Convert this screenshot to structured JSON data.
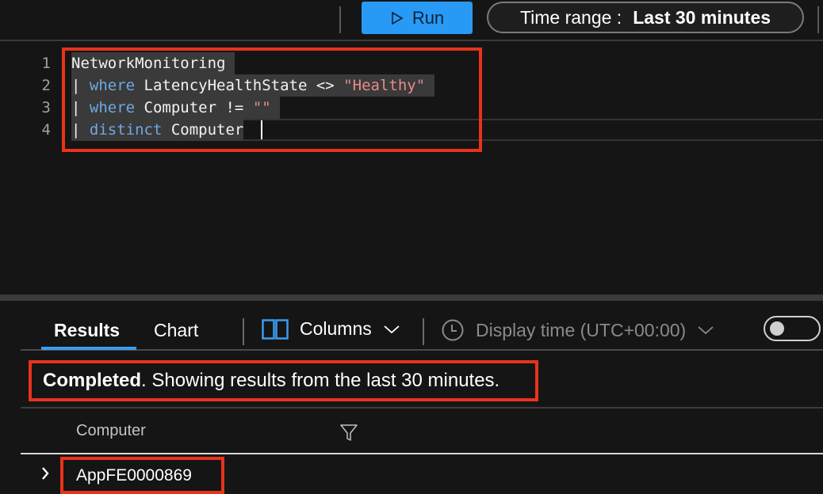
{
  "toolbar": {
    "run_label": "Run",
    "time_range_label": "Time range :",
    "time_range_value": "Last 30 minutes"
  },
  "editor": {
    "lines": [
      {
        "number": "1",
        "tokens": [
          {
            "type": "id",
            "text": "NetworkMonitoring"
          }
        ]
      },
      {
        "number": "2",
        "tokens": [
          {
            "type": "id",
            "text": "| "
          },
          {
            "type": "kw",
            "text": "where"
          },
          {
            "type": "id",
            "text": " LatencyHealthState <> "
          },
          {
            "type": "str",
            "text": "\"Healthy\""
          }
        ]
      },
      {
        "number": "3",
        "tokens": [
          {
            "type": "id",
            "text": "| "
          },
          {
            "type": "kw",
            "text": "where"
          },
          {
            "type": "id",
            "text": " Computer != "
          },
          {
            "type": "str",
            "text": "\"\""
          }
        ]
      },
      {
        "number": "4",
        "tokens": [
          {
            "type": "id",
            "text": "| "
          },
          {
            "type": "kw",
            "text": "distinct"
          },
          {
            "type": "id",
            "text": " Computer"
          }
        ]
      }
    ],
    "query_text": "NetworkMonitoring\n| where LatencyHealthState <> \"Healthy\"\n| where Computer != \"\"\n| distinct Computer"
  },
  "results": {
    "tabs": [
      {
        "label": "Results",
        "active": true
      },
      {
        "label": "Chart",
        "active": false
      }
    ],
    "columns_label": "Columns",
    "display_time_label": "Display time (UTC+00:00)",
    "toggle_on": false,
    "status_bold": "Completed",
    "status_rest": ". Showing results from the last 30 minutes.",
    "grid": {
      "columns": [
        "Computer"
      ],
      "rows": [
        [
          "AppFE0000869"
        ]
      ]
    }
  },
  "colors": {
    "accent": "#2899f5",
    "highlight_box": "#e8331c",
    "keyword": "#6fa8e6",
    "string": "#e88a8a"
  }
}
